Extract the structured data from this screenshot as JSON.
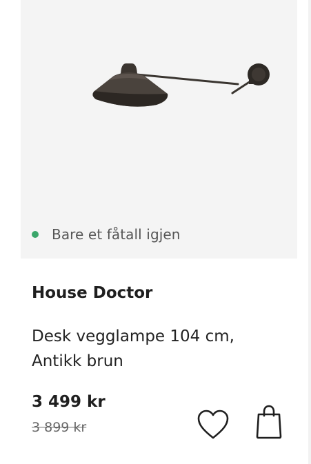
{
  "product": {
    "image": {
      "icon": "wall-lamp-image",
      "background": "#f4f4f4"
    },
    "stock_status": "Bare et fåtall igjen",
    "stock_color": "#3aa66a",
    "brand": "House Doctor",
    "title": "Desk vegglampe 104 cm, Antikk brun",
    "price": "3 499 kr",
    "old_price": "3 899 kr"
  },
  "actions": {
    "favorite_icon": "heart-icon",
    "cart_icon": "shopping-bag-icon"
  }
}
